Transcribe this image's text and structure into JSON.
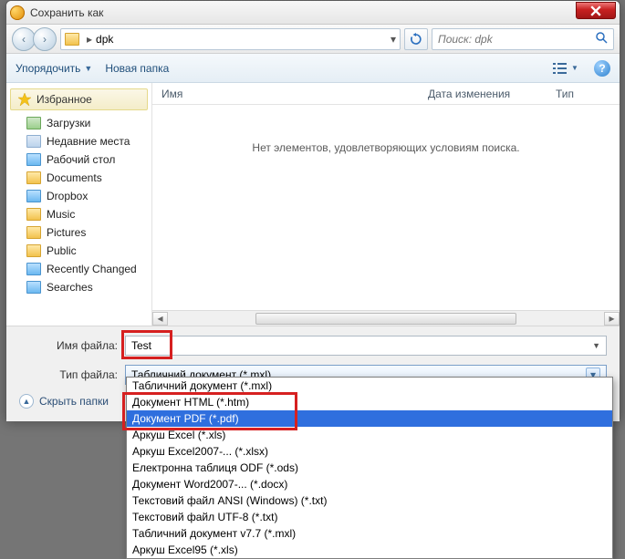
{
  "title": "Сохранить как",
  "breadcrumb": {
    "folder": "dpk"
  },
  "search": {
    "placeholder": "Поиск: dpk"
  },
  "toolbar": {
    "organize": "Упорядочить",
    "new_folder": "Новая папка"
  },
  "sidebar": {
    "favorites_header": "Избранное",
    "items": [
      "Загрузки",
      "Недавние места",
      "Рабочий стол",
      "Documents",
      "Dropbox",
      "Music",
      "Pictures",
      "Public",
      "Recently Changed",
      "Searches"
    ]
  },
  "columns": {
    "name": "Имя",
    "date": "Дата изменения",
    "type": "Тип"
  },
  "empty_message": "Нет элементов, удовлетворяющих условиям поиска.",
  "form": {
    "filename_label": "Имя файла:",
    "filename_value": "Test",
    "filetype_label": "Тип файла:",
    "filetype_value": "Табличний документ (*.mxl)",
    "hide_folders": "Скрыть папки"
  },
  "dropdown": {
    "items": [
      "Табличний документ (*.mxl)",
      "Документ HTML (*.htm)",
      "Документ PDF (*.pdf)",
      "Аркуш Excel (*.xls)",
      "Аркуш Excel2007-... (*.xlsx)",
      "Електронна таблиця ODF (*.ods)",
      "Документ Word2007-... (*.docx)",
      "Текстовий файл ANSI (Windows) (*.txt)",
      "Текстовий файл UTF-8 (*.txt)",
      "Табличний документ v7.7 (*.mxl)",
      "Аркуш Excel95 (*.xls)"
    ],
    "selected_index": 2
  }
}
